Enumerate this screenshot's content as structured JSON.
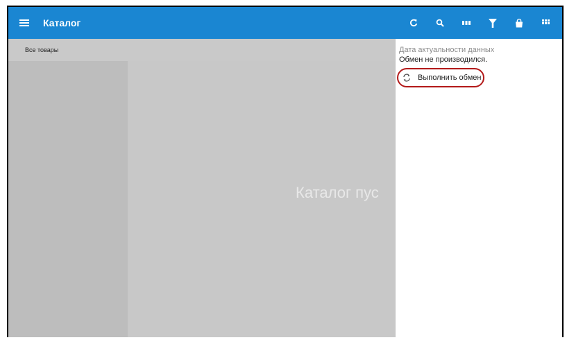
{
  "appbar": {
    "title": "Каталог",
    "color": "#1a86d2",
    "icons": [
      "menu-icon",
      "refresh-icon",
      "search-icon",
      "view-mode-icon",
      "filter-icon",
      "cart-icon",
      "grid-icon"
    ]
  },
  "catalog": {
    "breadcrumb": "Все товары",
    "empty_text": "Каталог пус"
  },
  "sync_panel": {
    "date_label": "Дата актуальности данных",
    "status": "Обмен не производился.",
    "sync_button_label": "Выполнить обмен",
    "highlight_color": "#b31a1a"
  }
}
